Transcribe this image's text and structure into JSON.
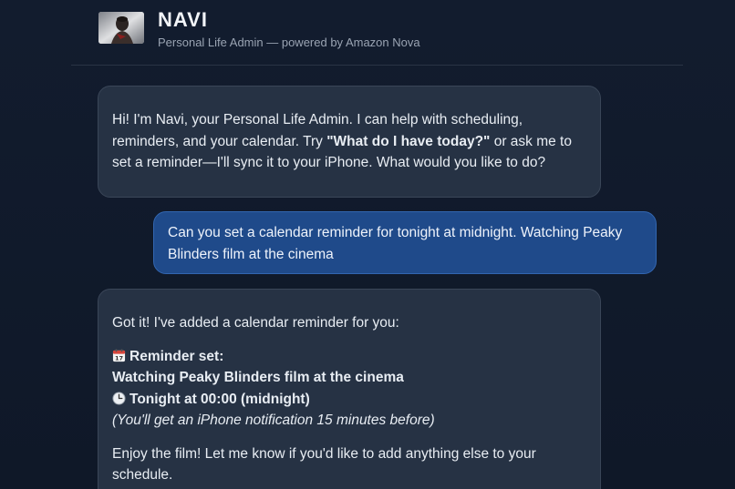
{
  "header": {
    "title": "NAVI",
    "subtitle": "Personal Life Admin — powered by Amazon Nova",
    "avatar_icon": "avatar-portrait"
  },
  "messages": [
    {
      "role": "assistant",
      "text_a": "Hi! I'm Navi, your Personal Life Admin. I can help with scheduling, reminders, and your calendar. Try ",
      "text_bold": "\"What do I have today?\"",
      "text_b": " or ask me to set a reminder—I'll sync it to your iPhone. What would you like to do?"
    },
    {
      "role": "user",
      "text": "Can you set a calendar reminder for tonight at midnight. Watching Peaky Blinders film at the cinema"
    },
    {
      "role": "assistant",
      "intro": "Got it! I've added a calendar reminder for you:",
      "reminder_label": "Reminder set:",
      "reminder_title": "Watching Peaky Blinders film at the cinema",
      "reminder_time": "Tonight at 00:00 (midnight)",
      "reminder_note": "(You'll get an iPhone notification 15 minutes before)",
      "outro": "Enjoy the film! Let me know if you'd like to add anything else to your schedule.",
      "calendar_icon": "calendar-icon",
      "clock_icon": "clock-icon",
      "clapper_icon": "clapper-board-icon"
    }
  ],
  "colors": {
    "background": "#111a2b",
    "assistant_bubble": "#263244",
    "user_bubble": "#1f4a8a",
    "user_bubble_border": "#3266b0"
  }
}
